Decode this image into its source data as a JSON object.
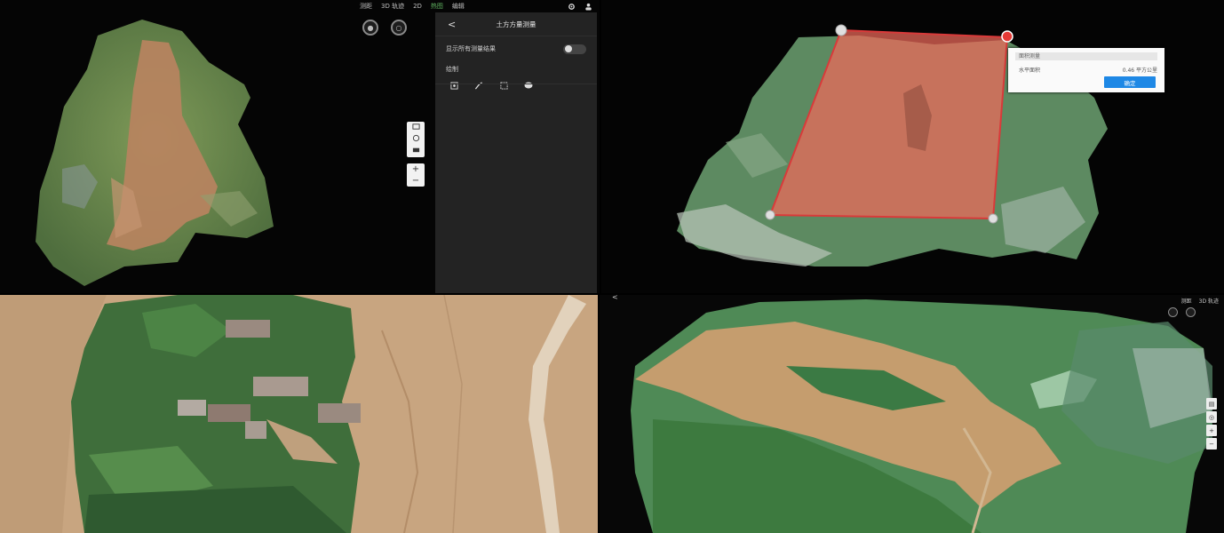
{
  "q1": {
    "topbar": {
      "items": [
        "测距",
        "3D 轨迹",
        "2D",
        "热图",
        "编辑"
      ],
      "right_icons": [
        "settings-icon",
        "user-icon"
      ]
    },
    "panel": {
      "back": "<",
      "title": "土方方量测量",
      "toggle_label": "显示所有测量结果",
      "section_label": "绘制",
      "tool_icons": [
        "point-icon",
        "line-icon",
        "area-icon",
        "volume-icon"
      ]
    },
    "map_controls": [
      "layers-icon",
      "compass-icon",
      "camera-icon",
      "zoom-in-icon",
      "zoom-out-icon"
    ],
    "zoom_in": "+",
    "zoom_out": "−"
  },
  "q2": {
    "popup": {
      "header": "面积测量",
      "label": "水平面积",
      "value": "0.46 平方公里",
      "button": "确定"
    }
  },
  "q4": {
    "toolbar": [
      "测距",
      "3D 轨迹"
    ],
    "side_icons": [
      "layers-icon",
      "compass-icon",
      "zoom-in-icon",
      "zoom-out-icon"
    ],
    "back": "<"
  },
  "colors": {
    "panel_bg": "#232323",
    "measure_fill": "#f06a5a",
    "accent_blue": "#1e88e5",
    "vertex_red": "#e53935"
  }
}
